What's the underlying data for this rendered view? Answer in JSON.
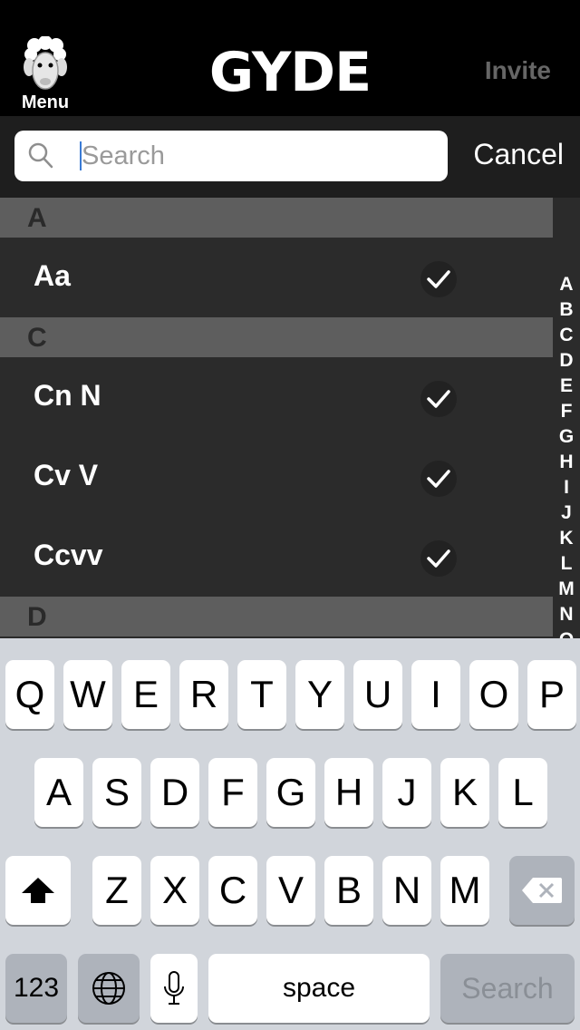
{
  "header": {
    "menu_label": "Menu",
    "logo": "GYDE",
    "invite": "Invite"
  },
  "search": {
    "placeholder": "Search",
    "value": "",
    "cancel": "Cancel"
  },
  "sections": [
    {
      "letter": "A",
      "items": [
        "Aa"
      ]
    },
    {
      "letter": "C",
      "items": [
        "Cn N",
        "Cv V",
        "Ccvv"
      ]
    },
    {
      "letter": "D",
      "items": []
    }
  ],
  "index_letters": [
    "A",
    "B",
    "C",
    "D",
    "E",
    "F",
    "G",
    "H",
    "I",
    "J",
    "K",
    "L",
    "M",
    "N",
    "O"
  ],
  "keyboard": {
    "row1": [
      "Q",
      "W",
      "E",
      "R",
      "T",
      "Y",
      "U",
      "I",
      "O",
      "P"
    ],
    "row2": [
      "A",
      "S",
      "D",
      "F",
      "G",
      "H",
      "J",
      "K",
      "L"
    ],
    "row3": [
      "Z",
      "X",
      "C",
      "V",
      "B",
      "N",
      "M"
    ],
    "numbers_label": "123",
    "space_label": "space",
    "search_label": "Search"
  }
}
